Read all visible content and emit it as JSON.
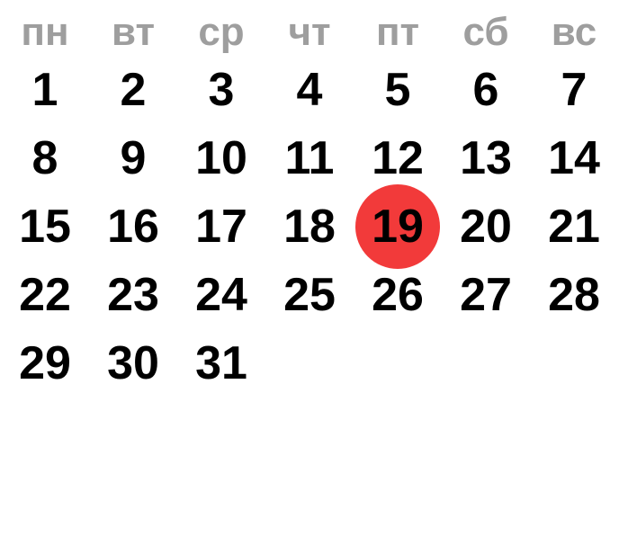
{
  "calendar": {
    "weekdays": [
      "пн",
      "вт",
      "ср",
      "чт",
      "пт",
      "сб",
      "вс"
    ],
    "days": [
      "1",
      "2",
      "3",
      "4",
      "5",
      "6",
      "7",
      "8",
      "9",
      "10",
      "11",
      "12",
      "13",
      "14",
      "15",
      "16",
      "17",
      "18",
      "19",
      "20",
      "21",
      "22",
      "23",
      "24",
      "25",
      "26",
      "27",
      "28",
      "29",
      "30",
      "31"
    ],
    "first_weekday_index": 0,
    "today": "19",
    "colors": {
      "weekday_text": "#9e9e9e",
      "day_text": "#000000",
      "today_highlight": "#f23a3a",
      "background": "#ffffff"
    }
  }
}
